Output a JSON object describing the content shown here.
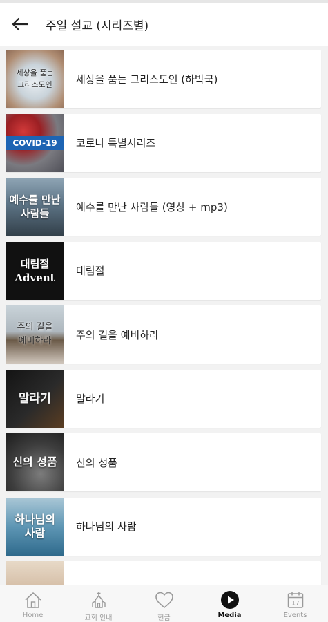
{
  "header": {
    "title": "주일 설교 (시리즈별)",
    "back_icon": "back-arrow-icon"
  },
  "series": [
    {
      "title": "세상을 품는 그리스도인 (하박국)",
      "thumb_text": "세상을 품는\n그리스도인"
    },
    {
      "title": "코로나 특별시리즈",
      "thumb_text": "COVID-19"
    },
    {
      "title": "예수를 만난 사람들 (영상 + mp3)",
      "thumb_text": "예수를 만난\n사람들"
    },
    {
      "title": "대림절",
      "thumb_text": "대림절\nAdvent"
    },
    {
      "title": "주의 길을 예비하라",
      "thumb_text": "주의 길을\n예비하라"
    },
    {
      "title": "말라기",
      "thumb_text": "말라기"
    },
    {
      "title": "신의 성품",
      "thumb_text": "신의 성품"
    },
    {
      "title": "하나님의 사람",
      "thumb_text": "하나님의\n사람"
    },
    {
      "title": "",
      "thumb_text": ""
    }
  ],
  "nav": {
    "items": [
      {
        "label": "Home",
        "icon": "home-icon",
        "active": false
      },
      {
        "label": "교회 안내",
        "icon": "church-icon",
        "active": false
      },
      {
        "label": "헌금",
        "icon": "heart-icon",
        "active": false
      },
      {
        "label": "Media",
        "icon": "play-circle-icon",
        "active": true
      },
      {
        "label": "Events",
        "icon": "calendar-icon",
        "active": false
      }
    ],
    "calendar_day": "17"
  },
  "colors": {
    "active": "#111111",
    "inactive": "#9a9a9a",
    "covid_banner": "#1d64b3"
  }
}
